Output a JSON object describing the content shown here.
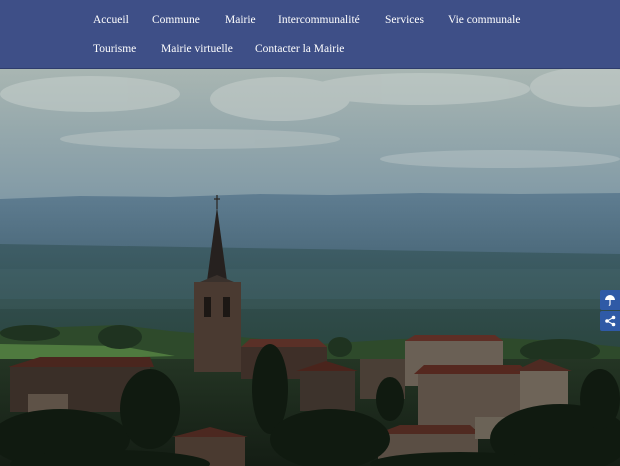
{
  "nav": {
    "row1": [
      {
        "label": "Accueil"
      },
      {
        "label": "Commune"
      },
      {
        "label": "Mairie"
      },
      {
        "label": "Intercommunalité"
      },
      {
        "label": "Services"
      },
      {
        "label": "Vie communale"
      }
    ],
    "row2": [
      {
        "label": "Tourisme"
      },
      {
        "label": "Mairie virtuelle"
      },
      {
        "label": "Contacter la Mairie"
      }
    ]
  },
  "side_buttons": [
    {
      "icon": "umbrella-icon"
    },
    {
      "icon": "share-icon"
    }
  ],
  "colors": {
    "nav_background": "#3e4f87",
    "nav_text": "#ffffff",
    "side_button": "#2f5aa6"
  }
}
